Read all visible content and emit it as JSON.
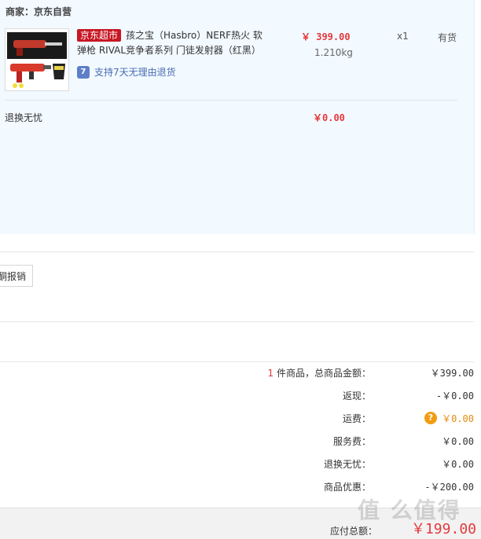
{
  "merchant": {
    "label": "商家：京东自营"
  },
  "item": {
    "tag": "京东超市",
    "title": "孩之宝（Hasbro）NERF热火 软弹枪 RIVAL竞争者系列 门徒发射器（红黑）",
    "price": "￥ 399.00",
    "weight": "1.210kg",
    "qty": "x1",
    "stock": "有货",
    "return_policy": "支持7天无理由退货",
    "return_icon_text": "7"
  },
  "worry_free": {
    "label": "退换无忧",
    "price": "￥0.00"
  },
  "reimburse_button": "酮报销",
  "summary": {
    "count": "1",
    "count_suffix": " 件商品，总商品金额：",
    "total_goods": "￥399.00",
    "cashback_label": "返现：",
    "cashback": "-￥0.00",
    "shipping_label": "运费：",
    "shipping": "￥0.00",
    "shipping_help": "?",
    "service_label": "服务费：",
    "service": "￥0.00",
    "worry_label": "退换无忧：",
    "worry": "￥0.00",
    "discount_label": "商品优惠：",
    "discount": "-￥200.00"
  },
  "footer": {
    "total_label": "应付总额：",
    "total": "￥199.00"
  },
  "watermark": "值 么值得"
}
